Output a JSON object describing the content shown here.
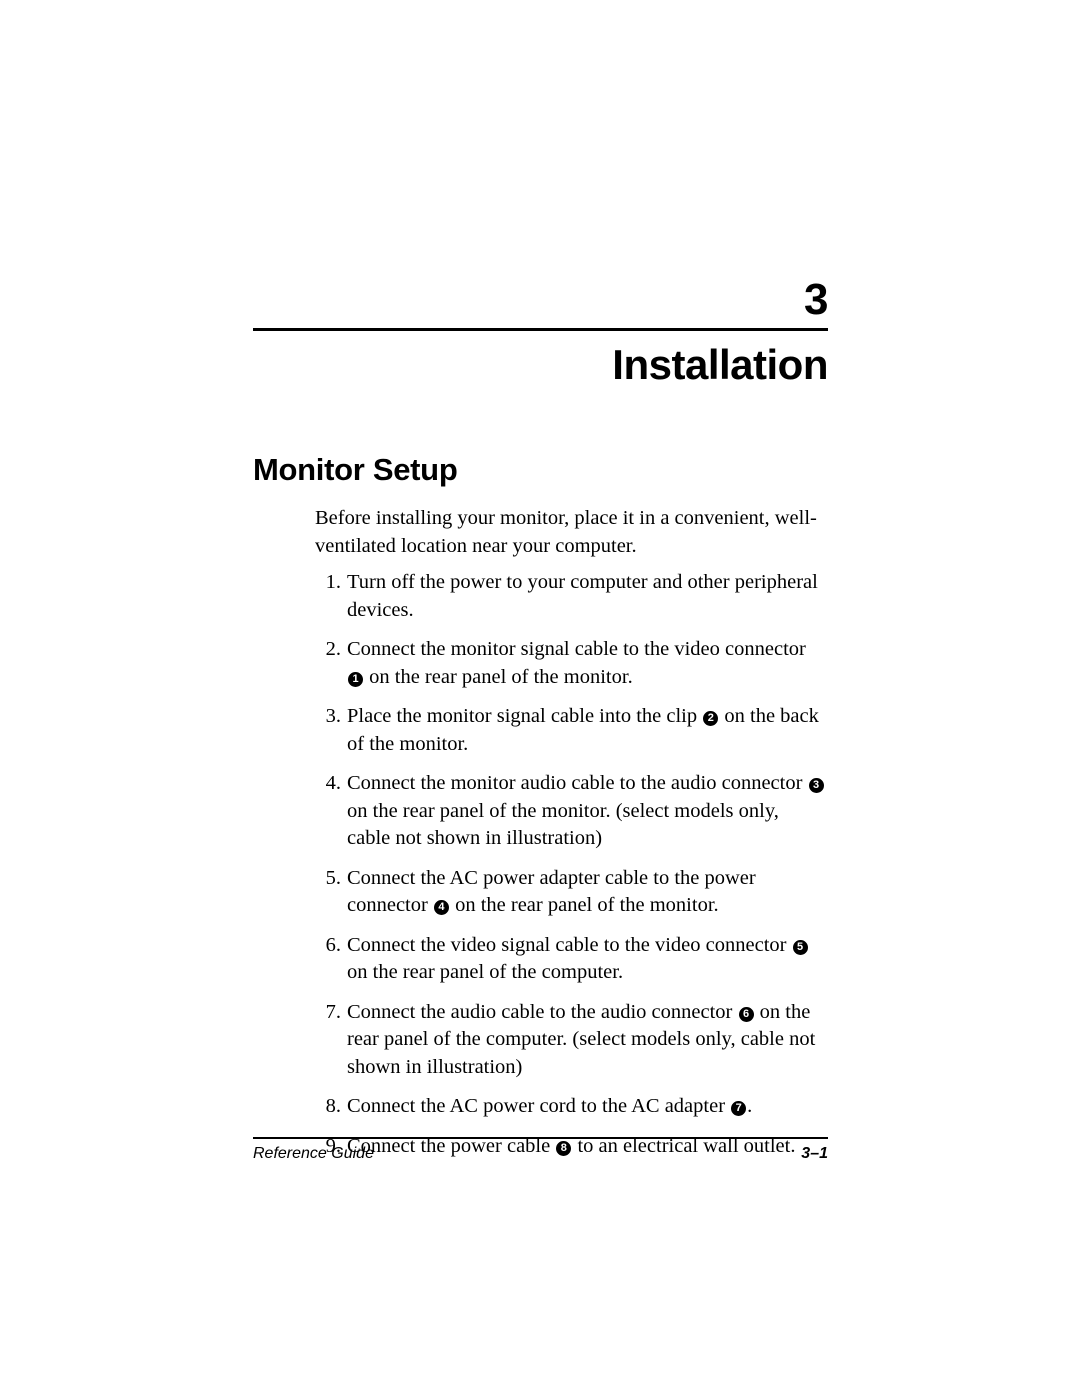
{
  "chapter": {
    "number": "3",
    "title": "Installation"
  },
  "section": {
    "heading": "Monitor Setup",
    "intro": "Before installing your monitor, place it in a convenient, well-ventilated location near your computer."
  },
  "steps": [
    {
      "marker": "1.",
      "parts": [
        {
          "type": "text",
          "value": "Turn off the power to your computer and other peripheral devices."
        }
      ]
    },
    {
      "marker": "2.",
      "parts": [
        {
          "type": "text",
          "value": "Connect the monitor signal cable to the video connector "
        },
        {
          "type": "callout",
          "value": "1"
        },
        {
          "type": "text",
          "value": " on the rear panel of the monitor."
        }
      ]
    },
    {
      "marker": "3.",
      "parts": [
        {
          "type": "text",
          "value": "Place the monitor signal cable into the clip "
        },
        {
          "type": "callout",
          "value": "2"
        },
        {
          "type": "text",
          "value": " on the back of the monitor."
        }
      ]
    },
    {
      "marker": "4.",
      "parts": [
        {
          "type": "text",
          "value": "Connect the monitor audio cable to the audio connector "
        },
        {
          "type": "callout",
          "value": "3"
        },
        {
          "type": "text",
          "value": " on the rear panel of the monitor. (select models only, cable not shown in illustration)"
        }
      ]
    },
    {
      "marker": "5.",
      "parts": [
        {
          "type": "text",
          "value": "Connect the AC power adapter cable to the power connector "
        },
        {
          "type": "callout",
          "value": "4"
        },
        {
          "type": "text",
          "value": " on the rear panel of the monitor."
        }
      ]
    },
    {
      "marker": "6.",
      "parts": [
        {
          "type": "text",
          "value": "Connect the video signal cable to the video connector "
        },
        {
          "type": "callout",
          "value": "5"
        },
        {
          "type": "text",
          "value": " on the rear panel of the computer."
        }
      ]
    },
    {
      "marker": "7.",
      "parts": [
        {
          "type": "text",
          "value": "Connect the audio cable to the audio connector "
        },
        {
          "type": "callout",
          "value": "6"
        },
        {
          "type": "text",
          "value": " on the rear panel of the computer. (select models only, cable not shown in illustration)"
        }
      ]
    },
    {
      "marker": "8.",
      "parts": [
        {
          "type": "text",
          "value": "Connect the AC power cord to the AC adapter "
        },
        {
          "type": "callout",
          "value": "7"
        },
        {
          "type": "text",
          "value": "."
        }
      ]
    },
    {
      "marker": "9.",
      "parts": [
        {
          "type": "text",
          "value": "Connect the power cable "
        },
        {
          "type": "callout",
          "value": "8"
        },
        {
          "type": "text",
          "value": " to an electrical wall outlet."
        }
      ]
    }
  ],
  "footer": {
    "left": "Reference Guide",
    "right": "3–1"
  }
}
